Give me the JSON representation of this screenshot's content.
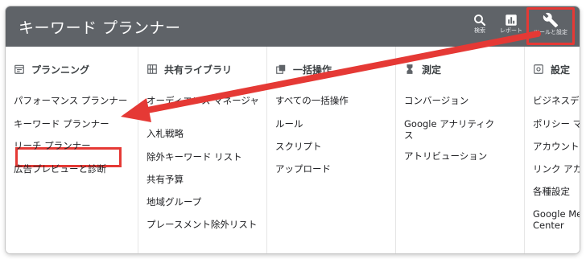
{
  "app_title": "キーワード プランナー",
  "toolbar": {
    "search_label": "検索",
    "report_label": "レポート",
    "settings_label": "ツールと設定"
  },
  "menu": {
    "planning": {
      "heading": "プランニング",
      "items": [
        "パフォーマンス プランナー",
        "キーワード プランナー",
        "リーチ プランナー",
        "広告プレビューと診断"
      ]
    },
    "shared_library": {
      "heading": "共有ライブラリ",
      "items": [
        "オーディエンス マネージャ",
        "入札戦略",
        "除外キーワード リスト",
        "共有予算",
        "地域グループ",
        "プレースメント除外リスト"
      ]
    },
    "bulk_actions": {
      "heading": "一括操作",
      "items": [
        "すべての一括操作",
        "ルール",
        "スクリプト",
        "アップロード"
      ]
    },
    "measurement": {
      "heading": "測定",
      "items": [
        "コンバージョン",
        "Google アナリティクス",
        "アトリビューション"
      ]
    },
    "settings": {
      "heading": "設定",
      "items": [
        "ビジネスデー",
        "ポリシー マ",
        "アカウント",
        "リンク アカ",
        "各種設定",
        "Google Mer\nCenter"
      ]
    }
  },
  "colors": {
    "topbar": "#5f6368",
    "highlight": "#e53935"
  },
  "icons": [
    "search-icon",
    "report-icon",
    "wrench-icon",
    "calendar-icon",
    "library-icon",
    "bulk-icon",
    "hourglass-icon",
    "settings-icon"
  ]
}
